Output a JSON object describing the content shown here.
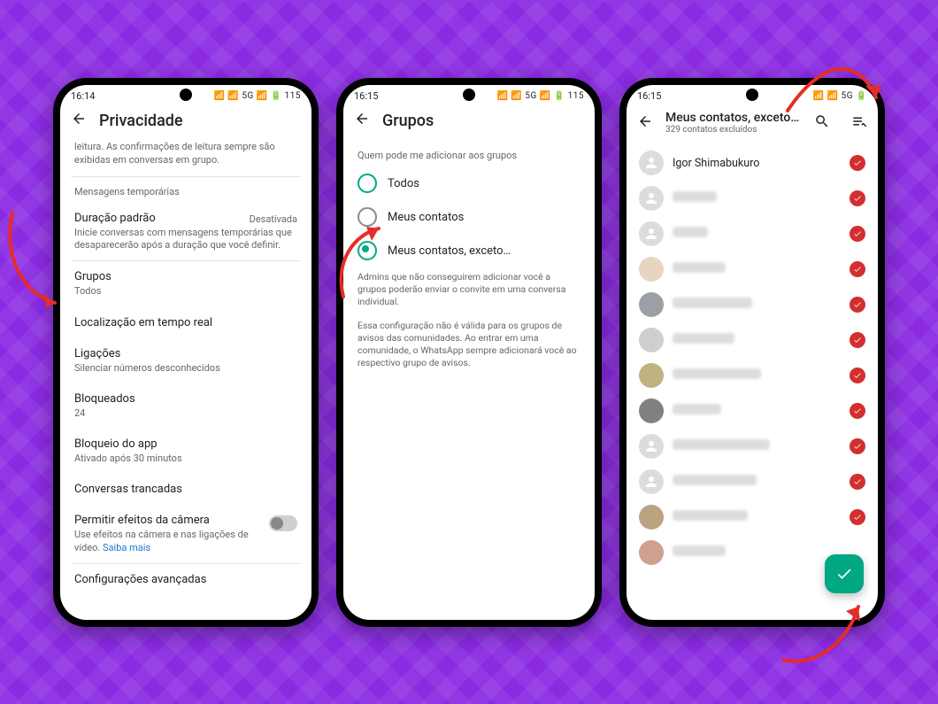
{
  "status": {
    "time1": "16:14",
    "time2": "16:15",
    "time3": "16:15",
    "right1": "📶 📶 5G 📶 🔋 115",
    "right2": "📶 📶 5G 📶 🔋 115",
    "right3": "📶 📶 5G 🔋"
  },
  "phone1": {
    "title": "Privacidade",
    "hint_top": "leitura. As confirmações de leitura sempre são exibidas em conversas em grupo.",
    "section_msg": "Mensagens temporárias",
    "dur_title": "Duração padrão",
    "dur_sub": "Inicie conversas com mensagens temporárias que desaparecerão após a duração que você definir.",
    "dur_value": "Desativada",
    "grupos_title": "Grupos",
    "grupos_sub": "Todos",
    "loc_title": "Localização em tempo real",
    "lig_title": "Ligações",
    "lig_sub": "Silenciar números desconhecidos",
    "bloq_title": "Bloqueados",
    "bloq_sub": "24",
    "app_title": "Bloqueio do app",
    "app_sub": "Ativado após 30 minutos",
    "conv_title": "Conversas trancadas",
    "cam_title": "Permitir efeitos da câmera",
    "cam_sub_a": "Use efeitos na câmera e nas ligações de vídeo. ",
    "cam_link": "Saiba mais",
    "adv_title": "Configurações avançadas"
  },
  "phone2": {
    "title": "Grupos",
    "question": "Quem pode me adicionar aos grupos",
    "opt1": "Todos",
    "opt2": "Meus contatos",
    "opt3": "Meus contatos, exceto…",
    "note1": "Admins que não conseguirem adicionar você a grupos poderão enviar o convite em uma conversa individual.",
    "note2": "Essa configuração não é válida para os grupos de avisos das comunidades. Ao entrar em uma comunidade, o WhatsApp sempre adicionará você ao respectivo grupo de avisos."
  },
  "phone3": {
    "title": "Meus contatos, exceto…",
    "sub": "329 contatos excluídos",
    "contact1": "Igor Shimabukuro"
  }
}
